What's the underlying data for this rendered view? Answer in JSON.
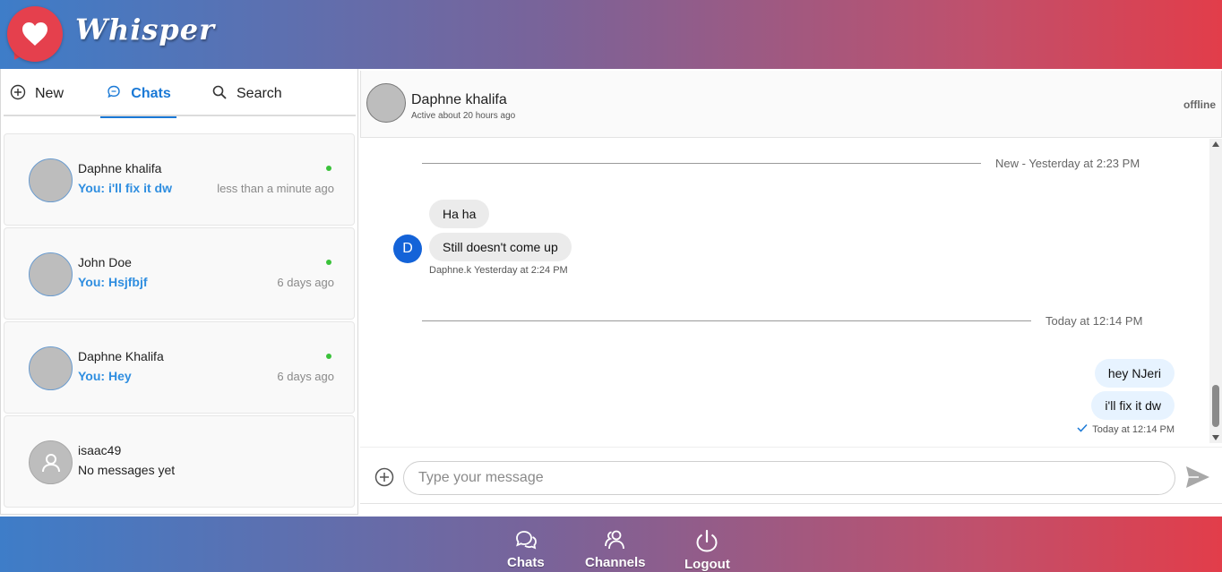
{
  "app": {
    "brand": "Whisper"
  },
  "left_tabs": {
    "new_label": "New",
    "chats_label": "Chats",
    "search_label": "Search"
  },
  "chats": [
    {
      "name": "Daphne khalifa",
      "preview": "You: i'll fix it dw",
      "time": "less than a minute ago",
      "online": true
    },
    {
      "name": "John Doe",
      "preview": "You: Hsjfbjf",
      "time": "6 days ago",
      "online": true
    },
    {
      "name": "Daphne Khalifa",
      "preview": "You: Hey",
      "time": "6 days ago",
      "online": true
    },
    {
      "name": "isaac49",
      "preview": "No messages yet",
      "time": "",
      "online": false
    }
  ],
  "conversation": {
    "name": "Daphne khalifa",
    "active": "Active about 20 hours ago",
    "status": "offline",
    "divider_1": "New - Yesterday at 2:23 PM",
    "incoming_initial": "D",
    "incoming_1": "Ha ha",
    "incoming_2": "Still doesn't come up",
    "incoming_meta": "Daphne.k Yesterday at 2:24 PM",
    "divider_2": "Today at 12:14 PM",
    "outgoing_1": "hey NJeri",
    "outgoing_2": "i'll fix it dw",
    "outgoing_meta": "Today at 12:14 PM"
  },
  "composer": {
    "placeholder": "Type your message"
  },
  "bottom_nav": {
    "chats": "Chats",
    "channels": "Channels",
    "logout": "Logout"
  },
  "colors": {
    "accent": "#1a79d6",
    "brand_red": "#e5404d",
    "online": "#3ac23a",
    "gradient_start": "#3e7dc8",
    "gradient_end": "#e23d4a"
  }
}
